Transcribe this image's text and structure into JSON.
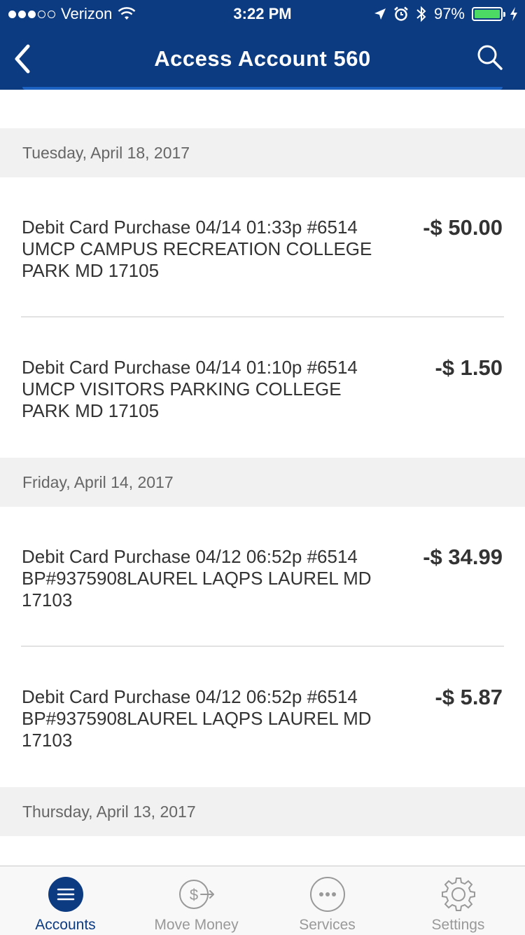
{
  "status_bar": {
    "carrier": "Verizon",
    "time": "3:22 PM",
    "battery": "97%",
    "signal_bars_filled": 3,
    "signal_bars_total": 5
  },
  "nav": {
    "title": "Access Account 560",
    "back_icon": "chevron-left-icon",
    "search_icon": "search-icon"
  },
  "colors": {
    "header_bg": "#0d3b82",
    "accent": "#1b62c2",
    "date_header_bg": "#f1f1f1",
    "battery_fill": "#4cd964"
  },
  "groups": [
    {
      "date": "Tuesday, April 18, 2017",
      "transactions": [
        {
          "description": "Debit Card Purchase 04/14 01:33p #6514 UMCP CAMPUS RECREATION COLLEGE PARK MD 17105",
          "amount": "-$ 50.00"
        },
        {
          "description": "Debit Card Purchase 04/14 01:10p #6514 UMCP VISITORS PARKING COLLEGE PARK MD 17105",
          "amount": "-$ 1.50"
        }
      ]
    },
    {
      "date": "Friday, April 14, 2017",
      "transactions": [
        {
          "description": "Debit Card Purchase 04/12 06:52p #6514 BP#9375908LAUREL LAQPS LAUREL MD 17103",
          "amount": "-$ 34.99"
        },
        {
          "description": "Debit Card Purchase 04/12 06:52p #6514 BP#9375908LAUREL LAQPS LAUREL MD 17103",
          "amount": "-$ 5.87"
        }
      ]
    },
    {
      "date": "Thursday, April 13, 2017",
      "transactions": []
    }
  ],
  "tabbar": {
    "tabs": [
      {
        "label": "Accounts",
        "icon": "menu-icon",
        "active": true
      },
      {
        "label": "Move Money",
        "icon": "dollar-transfer-icon",
        "active": false
      },
      {
        "label": "Services",
        "icon": "more-dots-icon",
        "active": false
      },
      {
        "label": "Settings",
        "icon": "gear-icon",
        "active": false
      }
    ]
  }
}
